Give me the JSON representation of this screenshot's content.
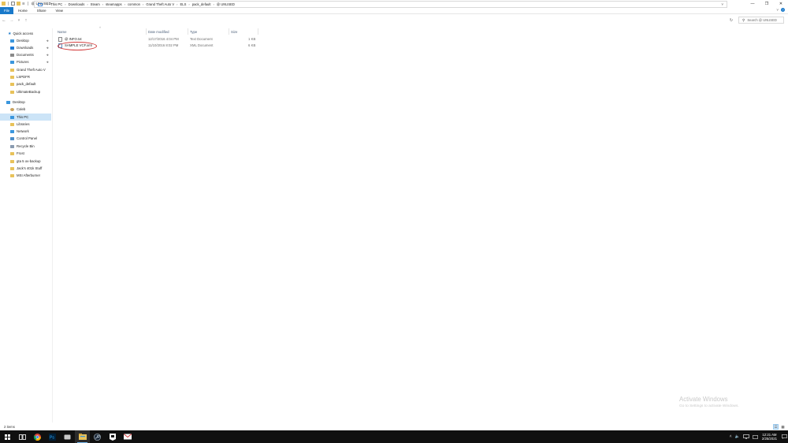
{
  "window": {
    "title": "@ UNUSED",
    "controls": {
      "minimize": "—",
      "restore": "❐",
      "close": "✕"
    },
    "quick_access_dropdown": "☰"
  },
  "ribbon": {
    "tabs": [
      "File",
      "Home",
      "Share",
      "View"
    ],
    "expand_glyph": "˅",
    "help_glyph": "?"
  },
  "nav_buttons": {
    "back": "←",
    "forward": "→",
    "recent": "˅",
    "up": "↑"
  },
  "address": {
    "crumbs": [
      "This PC",
      "Downloads",
      "Steam",
      "steamapps",
      "common",
      "Grand Theft Auto V",
      "ELS",
      "pack_default",
      "@ UNUSED"
    ],
    "separator": "›",
    "dropdown": "˅",
    "refresh": "↻"
  },
  "search": {
    "placeholder": "Search @ UNUSED",
    "icon": "search-icon"
  },
  "nav_pane": {
    "items": [
      {
        "label": "Quick access",
        "icon": "star-icon",
        "color": "#1979ca",
        "pinned": false
      },
      {
        "label": "Desktop",
        "icon": "desktop-icon",
        "color": "#3a96dd",
        "pinned": true
      },
      {
        "label": "Downloads",
        "icon": "downloads-icon",
        "color": "#1e7bd6",
        "pinned": true
      },
      {
        "label": "Documents",
        "icon": "documents-icon",
        "color": "#8a8a8a",
        "pinned": true
      },
      {
        "label": "Pictures",
        "icon": "pictures-icon",
        "color": "#3a96dd",
        "pinned": true
      },
      {
        "label": "Grand Theft Auto V",
        "icon": "folder-icon",
        "color": "#e8c25a",
        "pinned": false
      },
      {
        "label": "LSPDFR",
        "icon": "folder-icon",
        "color": "#e8c25a",
        "pinned": false
      },
      {
        "label": "pack_default",
        "icon": "folder-icon",
        "color": "#e8c25a",
        "pinned": false
      },
      {
        "label": "UltimateBackup",
        "icon": "folder-icon",
        "color": "#e8c25a",
        "pinned": false
      },
      {
        "label": "Desktop",
        "icon": "desktop-icon",
        "color": "#3a96dd",
        "pinned": false
      },
      {
        "label": "Caleb",
        "icon": "user-icon",
        "color": "#c9a25e",
        "pinned": false
      },
      {
        "label": "This PC",
        "icon": "pc-icon",
        "color": "#3a96dd",
        "pinned": false,
        "selected": true
      },
      {
        "label": "Libraries",
        "icon": "libraries-icon",
        "color": "#e8c25a",
        "pinned": false
      },
      {
        "label": "Network",
        "icon": "network-icon",
        "color": "#3a96dd",
        "pinned": false
      },
      {
        "label": "Control Panel",
        "icon": "control-panel-icon",
        "color": "#4b8dc9",
        "pinned": false
      },
      {
        "label": "Recycle Bin",
        "icon": "recycle-bin-icon",
        "color": "#8a9bb0",
        "pinned": false
      },
      {
        "label": "Frost",
        "icon": "folder-icon",
        "color": "#e8c25a",
        "pinned": false
      },
      {
        "label": "gta 5 ov-backup",
        "icon": "folder-icon",
        "color": "#e8c25a",
        "pinned": false
      },
      {
        "label": "Jack's 401k Stuff",
        "icon": "folder-icon",
        "color": "#e8c25a",
        "pinned": false
      },
      {
        "label": "MSI Afterburner",
        "icon": "folder-icon",
        "color": "#e8c25a",
        "pinned": false
      }
    ],
    "pin_glyph": "📌"
  },
  "columns": [
    "Name",
    "Date modified",
    "Type",
    "Size"
  ],
  "sort_caret": "˄",
  "files": [
    {
      "name": "@ INFO.txt",
      "date": "12/17/2016 4:04 PM",
      "type": "Text Document",
      "size": "1 KB",
      "icon": "text-file-icon"
    },
    {
      "name": "SAMPLE VCF.xml",
      "date": "11/10/2016 8:02 PM",
      "type": "XML Document",
      "size": "6 KB",
      "icon": "xml-file-icon"
    }
  ],
  "annotation_color": "#d23d3d",
  "status": {
    "count": "2 items"
  },
  "watermark": {
    "line1": "Activate Windows",
    "line2": "Go to Settings to activate Windows."
  },
  "taskbar": {
    "apps": [
      "start-icon",
      "task-view-icon",
      "chrome-icon",
      "photoshop-icon",
      "app-icon",
      "file-explorer-icon",
      "steam-icon",
      "epic-games-icon",
      "mail-icon"
    ],
    "tray_chevron": "˄",
    "time": "12:21 AM",
    "date": "2/25/2021"
  }
}
